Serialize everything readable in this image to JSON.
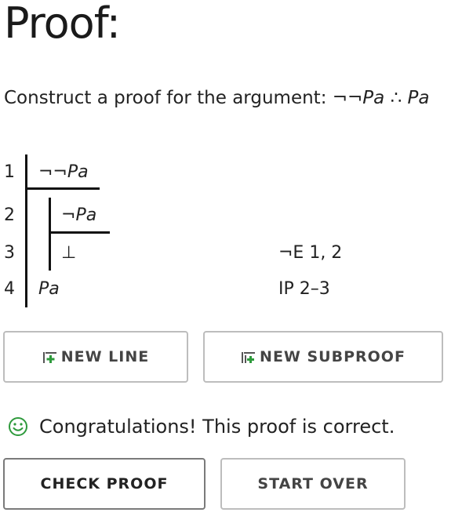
{
  "page": {
    "title": "Proof:",
    "instruction_prefix": "Construct a proof for the argument: ",
    "argument_premise": "¬¬Pa",
    "argument_therefore": " ∴ ",
    "argument_conclusion": "Pa"
  },
  "proof_lines": [
    {
      "number": "1",
      "neg": "¬¬",
      "atom": "Pa",
      "justification": ""
    },
    {
      "number": "2",
      "neg": "¬",
      "atom": "Pa",
      "justification": ""
    },
    {
      "number": "3",
      "neg": "⊥",
      "atom": "",
      "justification": "¬E 1, 2"
    },
    {
      "number": "4",
      "neg": "",
      "atom": "Pa",
      "justification": "IP 2–3"
    }
  ],
  "buttons": {
    "new_line": "NEW LINE",
    "new_subproof": "NEW SUBPROOF",
    "check_proof": "CHECK PROOF",
    "start_over": "START OVER"
  },
  "status": {
    "message": "Congratulations! This proof is correct.",
    "icon": "smiley-icon",
    "color": "#2e8b3d"
  },
  "colors": {
    "icon_green": "#2e9a3c"
  }
}
